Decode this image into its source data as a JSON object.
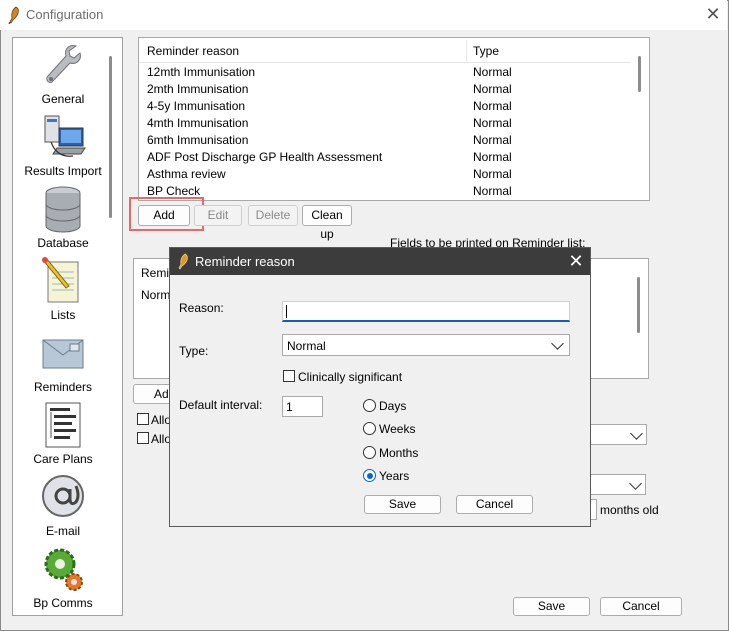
{
  "window": {
    "title": "Configuration",
    "close_glyph": "✕"
  },
  "sidebar": {
    "items": [
      {
        "label": "General",
        "icon": "wrench-icon"
      },
      {
        "label": "Results Import",
        "icon": "computer-network-icon"
      },
      {
        "label": "Database",
        "icon": "database-icon"
      },
      {
        "label": "Lists",
        "icon": "notepad-pencil-icon"
      },
      {
        "label": "Reminders",
        "icon": "envelope-icon"
      },
      {
        "label": "Care Plans",
        "icon": "document-tree-icon"
      },
      {
        "label": "E-mail",
        "icon": "at-sign-icon"
      },
      {
        "label": "Bp Comms",
        "icon": "gears-icon"
      }
    ]
  },
  "reminder_list": {
    "columns": [
      "Reminder reason",
      "Type"
    ],
    "rows": [
      [
        "12mth Immunisation",
        "Normal"
      ],
      [
        "2mth Immunisation",
        "Normal"
      ],
      [
        "4-5y Immunisation",
        "Normal"
      ],
      [
        "4mth Immunisation",
        "Normal"
      ],
      [
        "6mth Immunisation",
        "Normal"
      ],
      [
        "ADF Post Discharge GP Health Assessment",
        "Normal"
      ],
      [
        "Asthma review",
        "Normal"
      ],
      [
        "BP Check",
        "Normal"
      ]
    ]
  },
  "list_buttons": {
    "add": "Add",
    "edit": "Edit",
    "delete": "Delete",
    "cleanup": "Clean up"
  },
  "fields_label": "Fields to be printed on Reminder list:",
  "lower_list": {
    "partial_header": "Remin",
    "partial_row": "Norma"
  },
  "lower_buttons": {
    "add_partial": "Add"
  },
  "checkboxes": {
    "allow1_partial": "Allo",
    "allow2_partial": "Allo"
  },
  "months_old": "months old",
  "footer": {
    "save": "Save",
    "cancel": "Cancel"
  },
  "dialog": {
    "title": "Reminder reason",
    "close_glyph": "✕",
    "reason_label": "Reason:",
    "reason_value": "",
    "type_label": "Type:",
    "type_value": "Normal",
    "clinically_significant_label": "Clinically significant",
    "clinically_significant_checked": false,
    "default_interval_label": "Default interval:",
    "interval_value": "1",
    "units": [
      "Days",
      "Weeks",
      "Months",
      "Years"
    ],
    "selected_unit": "Years",
    "save": "Save",
    "cancel": "Cancel"
  },
  "colors": {
    "highlight": "#e06b6b",
    "dialog_title_bg": "#3c3c3c",
    "accent": "#0a63c9"
  }
}
